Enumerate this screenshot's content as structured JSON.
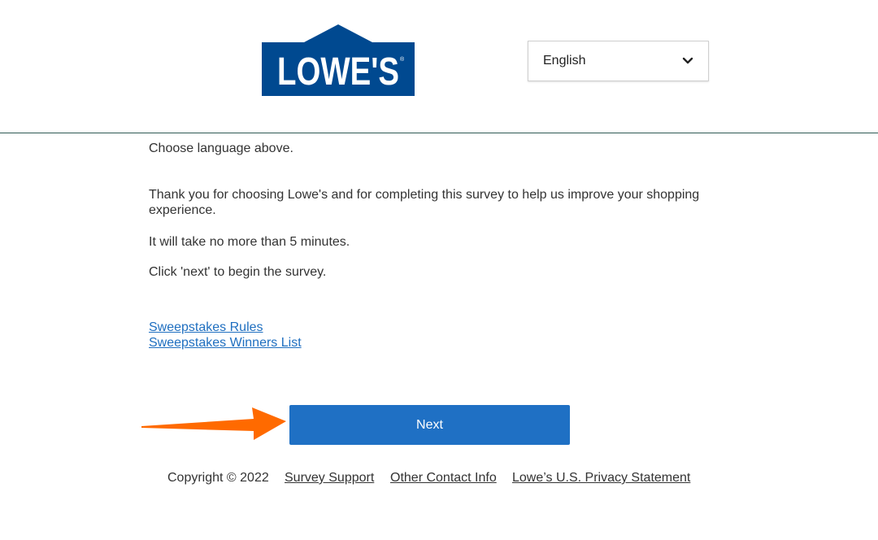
{
  "header": {
    "logo_text": "LOWE'S",
    "language_select": {
      "value": "English",
      "icon": "chevron-down-icon"
    }
  },
  "main": {
    "intro": "Choose language above.",
    "thanks": "Thank you for choosing Lowe's and for completing this survey to help us improve your shopping experience.",
    "minutes": "It will take no more than 5 minutes.",
    "click_next": "Click 'next' to begin the survey.",
    "links": {
      "rules": "Sweepstakes Rules",
      "winners": "Sweepstakes Winners List"
    },
    "next_button": "Next"
  },
  "footer": {
    "copyright": "Copyright © 2022",
    "links": [
      "Survey Support",
      "Other Contact Info",
      "Lowe’s U.S. Privacy Statement"
    ]
  },
  "colors": {
    "brand_blue": "#004990",
    "button_blue": "#1f70c4",
    "link_blue": "#1f6fc0",
    "arrow_orange": "#ff6a00",
    "divider": "#2f5a54"
  }
}
